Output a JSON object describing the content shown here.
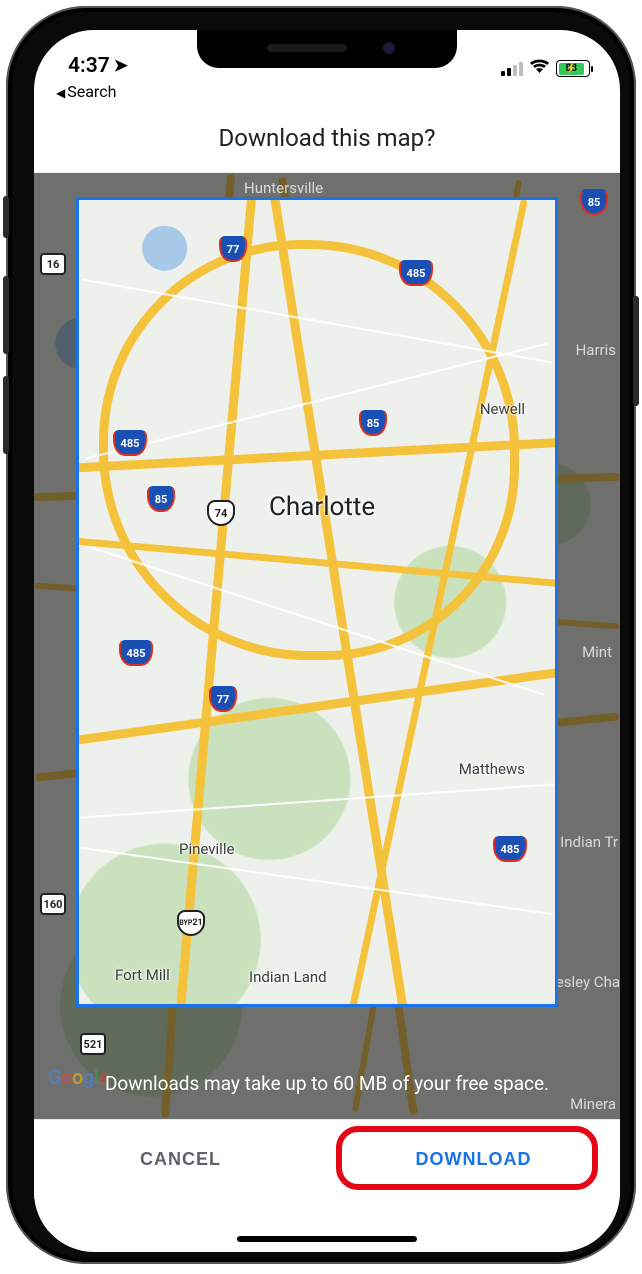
{
  "status": {
    "time": "4:37",
    "back_label": "Search",
    "battery_percent": "88"
  },
  "header": {
    "title": "Download this map?"
  },
  "map": {
    "main_city": "Charlotte",
    "labels_inside": {
      "newell": "Newell",
      "matthews": "Matthews",
      "pineville": "Pineville",
      "indian_land": "Indian Land",
      "fort_mill": "Fort Mill"
    },
    "labels_outside": {
      "huntersville": "Huntersville",
      "harris": "Harris",
      "mint": "Mint",
      "indian_tr": "Indian Tr",
      "wesley_ch": "Wesley Cha",
      "mineral": "Minera"
    },
    "shields": {
      "i77": "77",
      "i85": "85",
      "i485": "485",
      "us74": "74",
      "r16": "16",
      "r160": "160",
      "byp21": "21",
      "r521": "521"
    },
    "attribution": "Google",
    "hint": "Downloads may take up to 60 MB of your free space."
  },
  "actions": {
    "cancel": "CANCEL",
    "download": "DOWNLOAD"
  }
}
